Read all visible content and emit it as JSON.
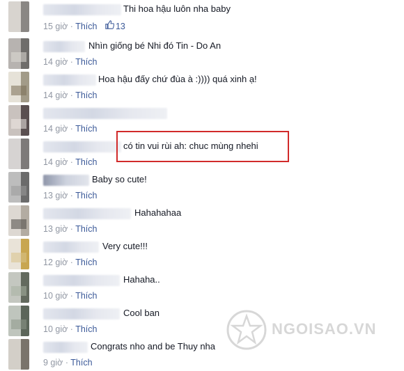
{
  "comments": [
    {
      "text": "Thi hoa hậu luôn nha baby",
      "time": "15 giờ",
      "like": "Thích",
      "likes": "13"
    },
    {
      "text": "Nhìn giống bé Nhi đó Tin - Do An",
      "time": "14 giờ",
      "like": "Thích"
    },
    {
      "text": "Hoa hậu đấy chứ đùa à :)))) quá xinh ạ!",
      "time": "14 giờ",
      "like": "Thích"
    },
    {
      "text": "",
      "time": "14 giờ",
      "like": "Thích"
    },
    {
      "text": "có tin vui rùi ah: chuc mùng nhehi",
      "time": "14 giờ",
      "like": "Thích"
    },
    {
      "text": "Baby so cute!",
      "time": "13 giờ",
      "like": "Thích"
    },
    {
      "text": "Hahahahaa",
      "time": "13 giờ",
      "like": "Thích"
    },
    {
      "text": "Very cute!!!",
      "time": "12 giờ",
      "like": "Thích"
    },
    {
      "text": "Hahaha..",
      "time": "10 giờ",
      "like": "Thích"
    },
    {
      "text": "Cool ban",
      "time": "10 giờ",
      "like": "Thích"
    },
    {
      "text": "Congrats nho and be Thuy nha",
      "time": "9 giờ",
      "like": "Thích"
    }
  ],
  "watermark": {
    "text": "NGOISAO.VN"
  },
  "colors": {
    "link": "#3b5998",
    "meta": "#9197a3",
    "text": "#141823",
    "highlight": "#d12a2a"
  },
  "icons": {
    "like": "thumbs-up-icon"
  }
}
